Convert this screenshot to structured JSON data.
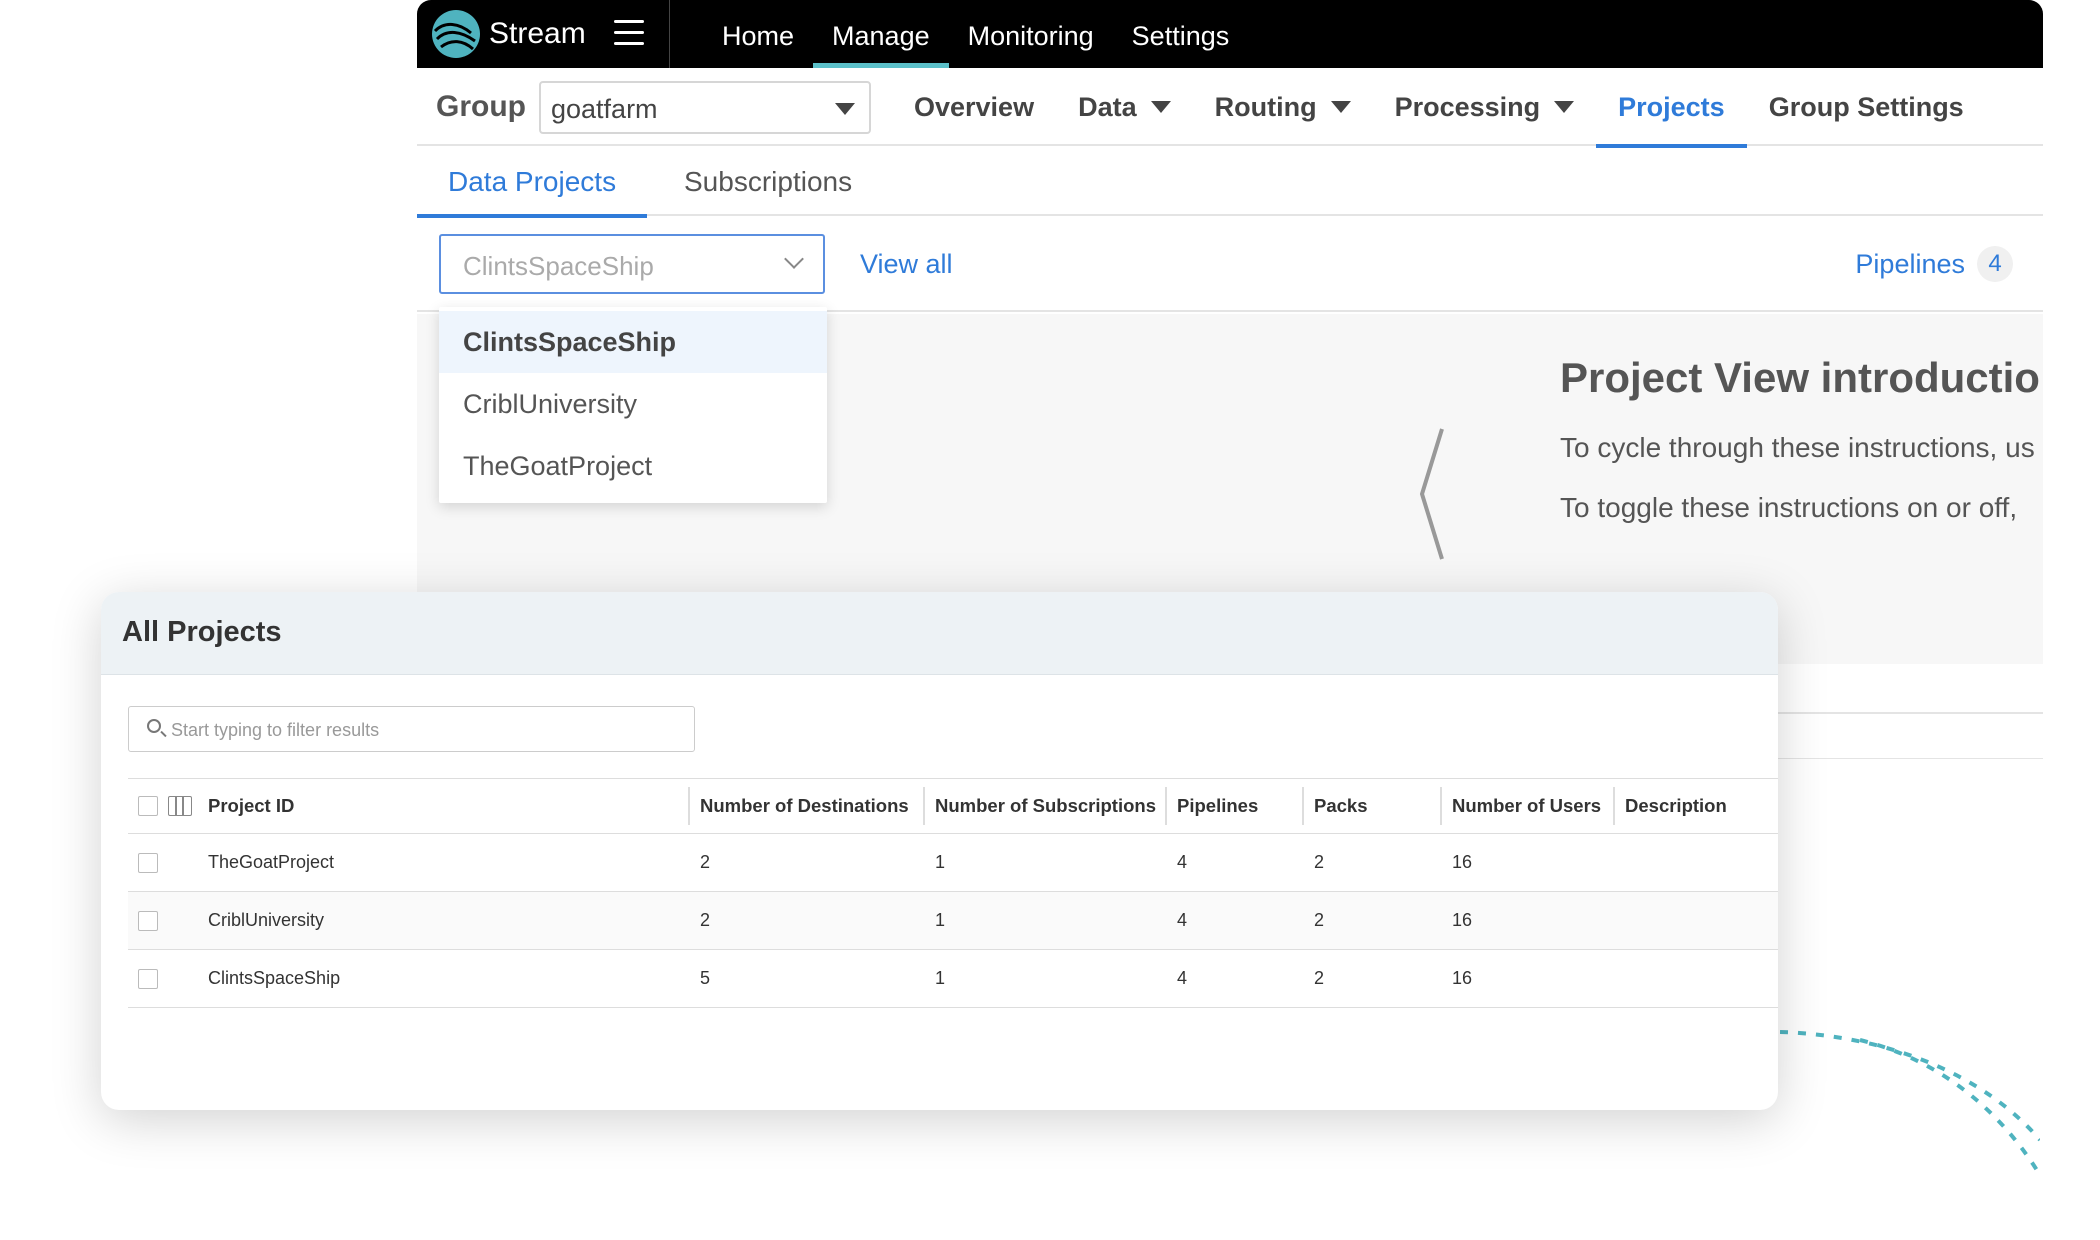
{
  "brand": {
    "name": "Stream",
    "accent": "#5bc0c9"
  },
  "topnav": {
    "items": [
      "Home",
      "Manage",
      "Monitoring",
      "Settings"
    ],
    "active": "Manage"
  },
  "group": {
    "label": "Group",
    "selected": "goatfarm",
    "tabs": [
      "Overview",
      "Data",
      "Routing",
      "Processing",
      "Projects",
      "Group Settings"
    ],
    "active": "Projects"
  },
  "subtabs": {
    "items": [
      "Data Projects",
      "Subscriptions"
    ],
    "active": "Data Projects"
  },
  "toolbar": {
    "project_select_value": "ClintsSpaceShip",
    "view_all": "View all",
    "pipelines_label": "Pipelines",
    "pipelines_count": "4"
  },
  "dropdown": {
    "options": [
      "ClintsSpaceShip",
      "CriblUniversity",
      "TheGoatProject"
    ],
    "selected": "ClintsSpaceShip"
  },
  "intro": {
    "title": "Project View introductio",
    "line1": "To cycle through these instructions, us",
    "line2": "To toggle these instructions on or off,"
  },
  "all_projects": {
    "title": "All Projects",
    "filter_placeholder": "Start typing to filter results",
    "columns": [
      "Project ID",
      "Number of Destinations",
      "Number of Subscriptions",
      "Pipelines",
      "Packs",
      "Number of Users",
      "Description"
    ],
    "rows": [
      {
        "project_id": "TheGoatProject",
        "destinations": "2",
        "subscriptions": "1",
        "pipelines": "4",
        "packs": "2",
        "users": "16",
        "description": ""
      },
      {
        "project_id": "CriblUniversity",
        "destinations": "2",
        "subscriptions": "1",
        "pipelines": "4",
        "packs": "2",
        "users": "16",
        "description": ""
      },
      {
        "project_id": "ClintsSpaceShip",
        "destinations": "5",
        "subscriptions": "1",
        "pipelines": "4",
        "packs": "2",
        "users": "16",
        "description": ""
      }
    ]
  },
  "colors": {
    "link_blue": "#2f7bd9",
    "topbar": "#000000",
    "card_header": "#edf2f5"
  }
}
